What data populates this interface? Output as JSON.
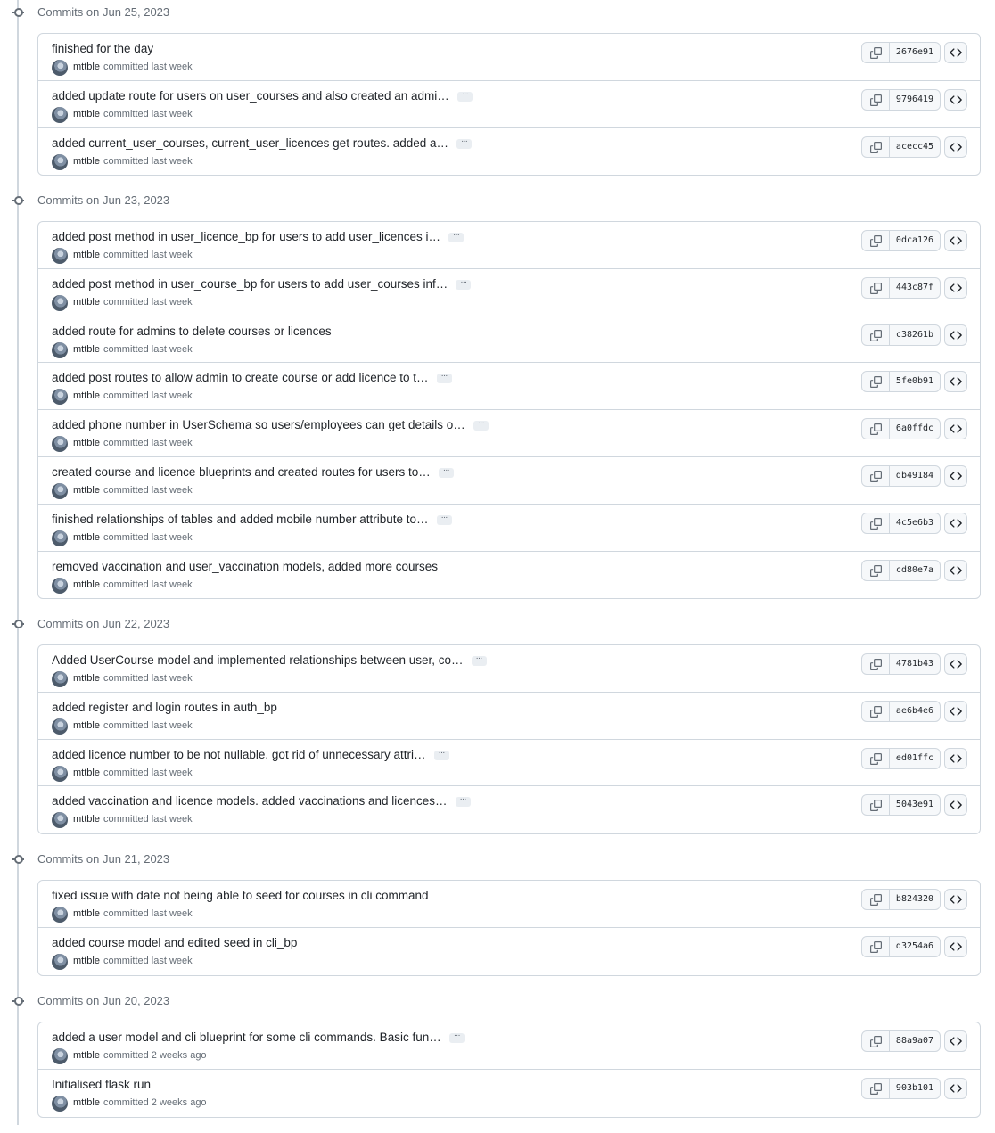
{
  "groups": [
    {
      "title": "Commits on Jun 25, 2023",
      "commits": [
        {
          "message": "finished for the day",
          "author": "mttble",
          "when": "committed last week",
          "sha": "2676e91",
          "has_more": false
        },
        {
          "message": "added update route for users on user_courses and also created an admi…",
          "author": "mttble",
          "when": "committed last week",
          "sha": "9796419",
          "has_more": true
        },
        {
          "message": "added current_user_courses, current_user_licences get routes. added a…",
          "author": "mttble",
          "when": "committed last week",
          "sha": "acecc45",
          "has_more": true
        }
      ]
    },
    {
      "title": "Commits on Jun 23, 2023",
      "commits": [
        {
          "message": "added post method in user_licence_bp for users to add user_licences i…",
          "author": "mttble",
          "when": "committed last week",
          "sha": "0dca126",
          "has_more": true
        },
        {
          "message": "added post method in user_course_bp for users to add user_courses inf…",
          "author": "mttble",
          "when": "committed last week",
          "sha": "443c87f",
          "has_more": true
        },
        {
          "message": "added route for admins to delete courses or licences",
          "author": "mttble",
          "when": "committed last week",
          "sha": "c38261b",
          "has_more": false
        },
        {
          "message": "added post routes to allow admin to create course or add licence to t…",
          "author": "mttble",
          "when": "committed last week",
          "sha": "5fe0b91",
          "has_more": true
        },
        {
          "message": "added phone number in UserSchema so users/employees can get details o…",
          "author": "mttble",
          "when": "committed last week",
          "sha": "6a0ffdc",
          "has_more": true
        },
        {
          "message": "created course and licence blueprints and created routes for users to…",
          "author": "mttble",
          "when": "committed last week",
          "sha": "db49184",
          "has_more": true
        },
        {
          "message": "finished relationships of tables and added mobile number attribute to…",
          "author": "mttble",
          "when": "committed last week",
          "sha": "4c5e6b3",
          "has_more": true
        },
        {
          "message": "removed vaccination and user_vaccination models, added more courses",
          "author": "mttble",
          "when": "committed last week",
          "sha": "cd80e7a",
          "has_more": false
        }
      ]
    },
    {
      "title": "Commits on Jun 22, 2023",
      "commits": [
        {
          "message": "Added UserCourse model and implemented relationships between user, co…",
          "author": "mttble",
          "when": "committed last week",
          "sha": "4781b43",
          "has_more": true
        },
        {
          "message": "added register and login routes in auth_bp",
          "author": "mttble",
          "when": "committed last week",
          "sha": "ae6b4e6",
          "has_more": false
        },
        {
          "message": "added licence number to be not nullable. got rid of unnecessary attri…",
          "author": "mttble",
          "when": "committed last week",
          "sha": "ed01ffc",
          "has_more": true
        },
        {
          "message": "added vaccination and licence models. added vaccinations and licences…",
          "author": "mttble",
          "when": "committed last week",
          "sha": "5043e91",
          "has_more": true
        }
      ]
    },
    {
      "title": "Commits on Jun 21, 2023",
      "commits": [
        {
          "message": "fixed issue with date not being able to seed for courses in cli command",
          "author": "mttble",
          "when": "committed last week",
          "sha": "b824320",
          "has_more": false
        },
        {
          "message": "added course model and edited seed in cli_bp",
          "author": "mttble",
          "when": "committed last week",
          "sha": "d3254a6",
          "has_more": false
        }
      ]
    },
    {
      "title": "Commits on Jun 20, 2023",
      "commits": [
        {
          "message": "added a user model and cli blueprint for some cli commands. Basic fun…",
          "author": "mttble",
          "when": "committed 2 weeks ago",
          "sha": "88a9a07",
          "has_more": true
        },
        {
          "message": "Initialised flask run",
          "author": "mttble",
          "when": "committed 2 weeks ago",
          "sha": "903b101",
          "has_more": false
        }
      ]
    }
  ],
  "icons": {
    "group": "git-commit-icon",
    "copy": "copy-icon",
    "browse": "code-icon",
    "more": "ellipsis-icon"
  },
  "colors": {
    "border": "#d0d7de",
    "muted_text": "#656d76",
    "text": "#1f2328",
    "button_bg": "#f6f8fa"
  }
}
